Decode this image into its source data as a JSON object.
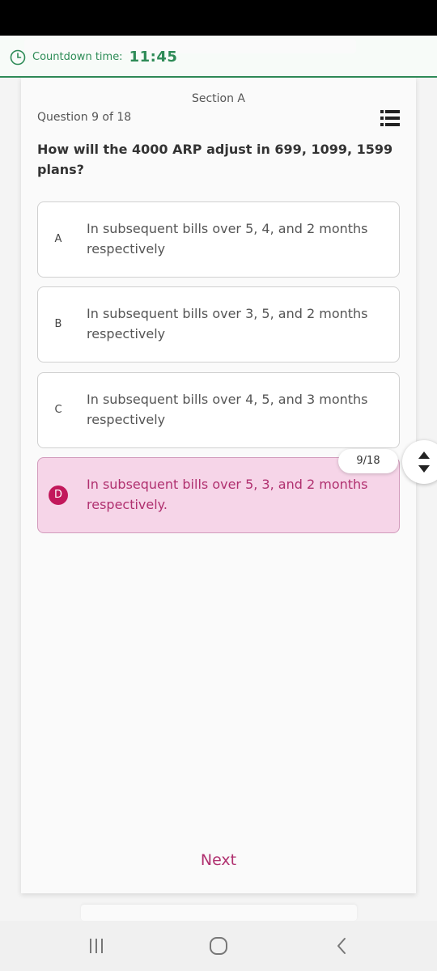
{
  "timer": {
    "label": "Countdown time:",
    "value": "11:45"
  },
  "quiz": {
    "section": "Section A",
    "counter": "Question 9 of 18",
    "question": "How will the 4000 ARP adjust in 699, 1099, 1599 plans?",
    "options": [
      {
        "letter": "A",
        "text": "In subsequent bills over 5, 4, and 2 months respectively"
      },
      {
        "letter": "B",
        "text": "In subsequent bills over 3, 5, and 2 months respectively"
      },
      {
        "letter": "C",
        "text": "In subsequent bills over 4, 5, and 3 months respectively"
      },
      {
        "letter": "D",
        "text": "In subsequent bills over 5, 3, and 2 months respectively."
      }
    ],
    "selected": "D",
    "progress_badge": "9/18",
    "next_label": "Next"
  },
  "colors": {
    "accent_green": "#2e8b57",
    "accent_pink": "#c2185b",
    "selected_bg": "#f6d5e8"
  },
  "icons": {
    "timer": "clock-icon",
    "question_list": "list-icon",
    "scroll": "scroll-updown-icon",
    "nav_recents": "recents-icon",
    "nav_home": "home-icon",
    "nav_back": "back-icon"
  }
}
